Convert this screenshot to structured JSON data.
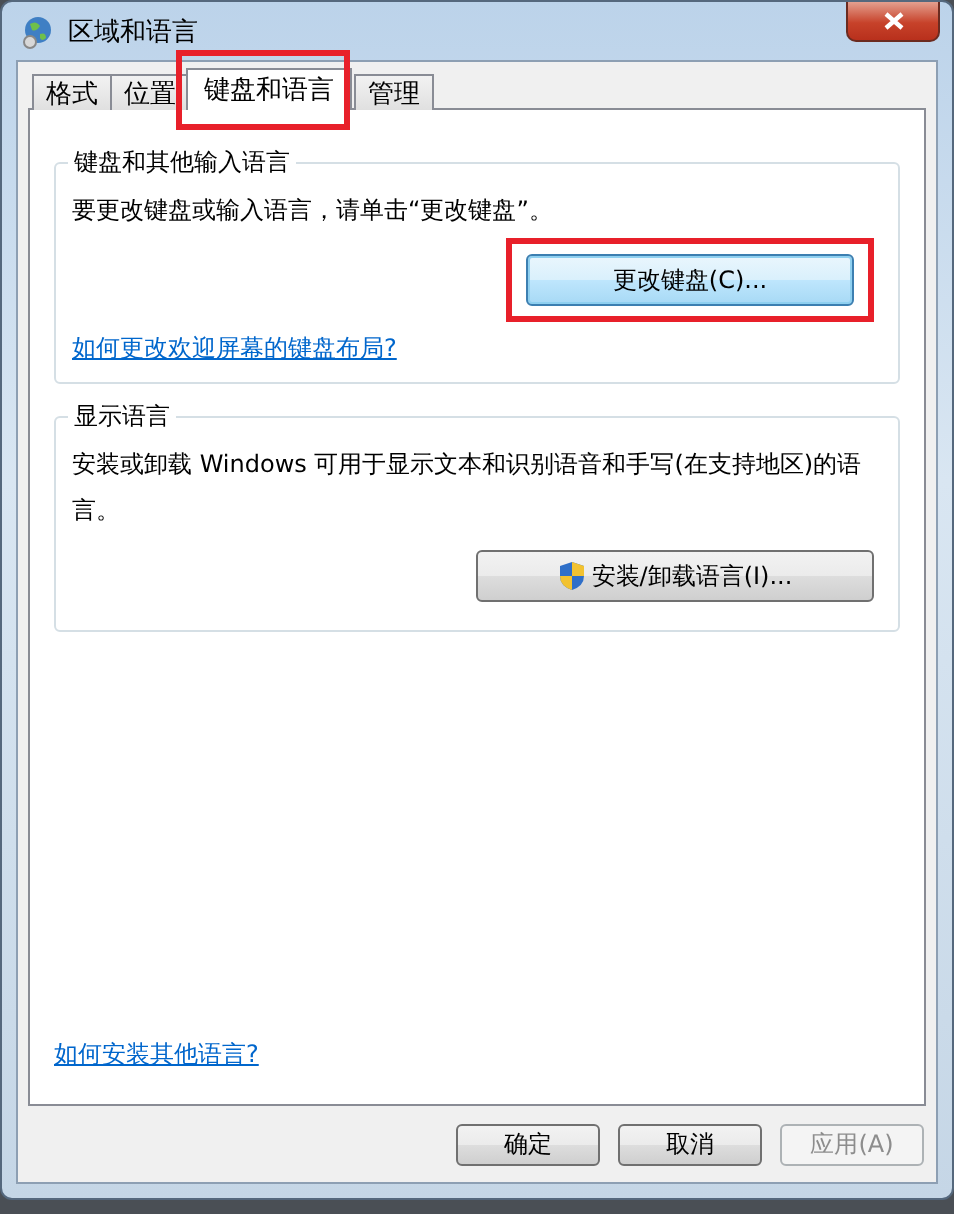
{
  "window": {
    "title": "区域和语言"
  },
  "tabs": [
    {
      "label": "格式",
      "selected": false,
      "highlighted": false
    },
    {
      "label": "位置",
      "selected": false,
      "highlighted": false
    },
    {
      "label": "键盘和语言",
      "selected": true,
      "highlighted": true
    },
    {
      "label": "管理",
      "selected": false,
      "highlighted": false
    }
  ],
  "groups": [
    {
      "title": "键盘和其他输入语言",
      "description": "要更改键盘或输入语言，请单击“更改键盘”。",
      "button": {
        "label": "更改键盘(C)...",
        "shield": false,
        "focused": true,
        "highlighted": true
      },
      "link": "如何更改欢迎屏幕的键盘布局?"
    },
    {
      "title": "显示语言",
      "description": "安装或卸载 Windows 可用于显示文本和识别语音和手写(在支持地区)的语言。",
      "button": {
        "label": "安装/卸载语言(I)...",
        "shield": true,
        "focused": false,
        "highlighted": false
      }
    }
  ],
  "footer_link": "如何安装其他语言?",
  "buttons": [
    {
      "label": "确定",
      "disabled": false
    },
    {
      "label": "取消",
      "disabled": false
    },
    {
      "label": "应用(A)",
      "disabled": true
    }
  ]
}
